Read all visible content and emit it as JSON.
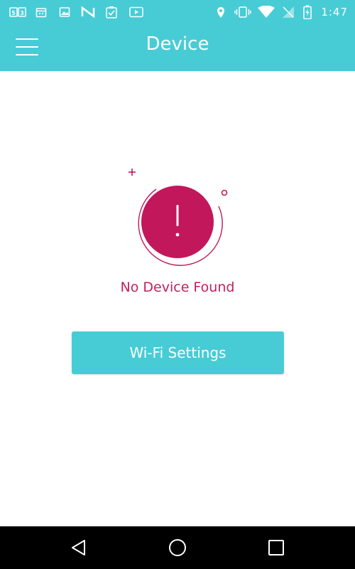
{
  "status_bar": {
    "time": "1:47",
    "left_icons": [
      "sim-icon",
      "calendar-icon",
      "photos-icon",
      "n-icon",
      "clipboard-icon",
      "youtube-icon"
    ],
    "right_icons": [
      "location-icon",
      "vibrate-icon",
      "wifi-icon",
      "no-signal-icon",
      "battery-charging-icon"
    ]
  },
  "app_bar": {
    "title": "Device",
    "menu_icon": "hamburger-menu-icon"
  },
  "empty_state": {
    "message": "No Device Found",
    "illustration_icon": "alert-circle-icon"
  },
  "actions": {
    "wifi_settings_label": "Wi-Fi Settings"
  },
  "nav_bar": {
    "buttons": [
      "back-icon",
      "home-icon",
      "recents-icon"
    ]
  },
  "colors": {
    "accent": "#47ccd6",
    "alert": "#c2185b",
    "text_on_accent": "#ffffff",
    "nav_bg": "#000000"
  }
}
